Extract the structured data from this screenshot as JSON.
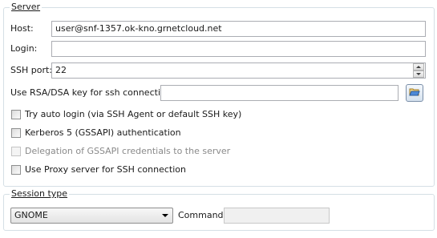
{
  "server_group": {
    "title": "Server",
    "host_label": "Host:",
    "host_value": "user@snf-1357.ok-kno.grnetcloud.net",
    "login_label": "Login:",
    "login_value": "",
    "ssh_port_label": "SSH port:",
    "ssh_port_value": "22",
    "rsa_key_label": "Use RSA/DSA key for ssh connection:",
    "rsa_key_value": "",
    "auto_login_label": "Try auto login (via SSH Agent or default SSH key)",
    "kerberos_label": "Kerberos 5 (GSSAPI) authentication",
    "delegation_label": "Delegation of GSSAPI credentials to the server",
    "proxy_label": "Use Proxy server for SSH connection"
  },
  "session_group": {
    "title": "Session type",
    "session_value": "GNOME",
    "command_label": "Command:",
    "command_value": ""
  },
  "icons": {
    "browse": "folder-open-icon",
    "spin_up": "chevron-up-icon",
    "spin_down": "chevron-down-icon",
    "combo_arrow": "chevron-down-icon"
  },
  "colors": {
    "group_border": "#d5dfe5",
    "input_border": "#abadb3",
    "disabled_text": "#8a8a8a"
  }
}
